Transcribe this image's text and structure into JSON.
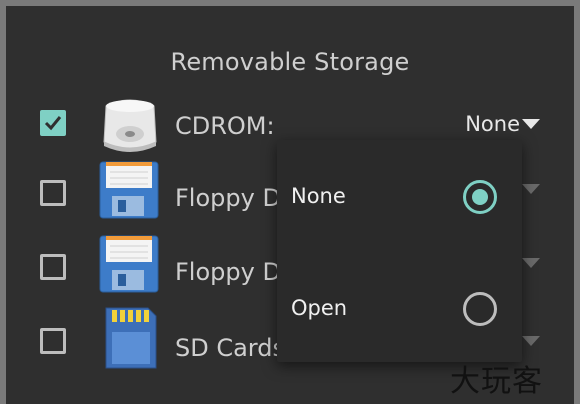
{
  "title": "Removable Storage",
  "rows": [
    {
      "label": "CDROM:",
      "checked": true,
      "value": "None",
      "icon": "cdrom-icon"
    },
    {
      "label": "Floppy D",
      "checked": false,
      "value": "",
      "icon": "floppy-icon"
    },
    {
      "label": "Floppy D",
      "checked": false,
      "value": "",
      "icon": "floppy-icon"
    },
    {
      "label": "SD Cards",
      "checked": false,
      "value": "",
      "icon": "sd-card-icon"
    }
  ],
  "popup": {
    "options": [
      {
        "label": "None",
        "selected": true
      },
      {
        "label": "Open",
        "selected": false
      }
    ]
  },
  "watermark": "大玩客",
  "colors": {
    "accent": "#7fd0c4",
    "panel": "#2f2f2f",
    "popup": "#2a2a2a",
    "frame": "#7a7a7a"
  }
}
